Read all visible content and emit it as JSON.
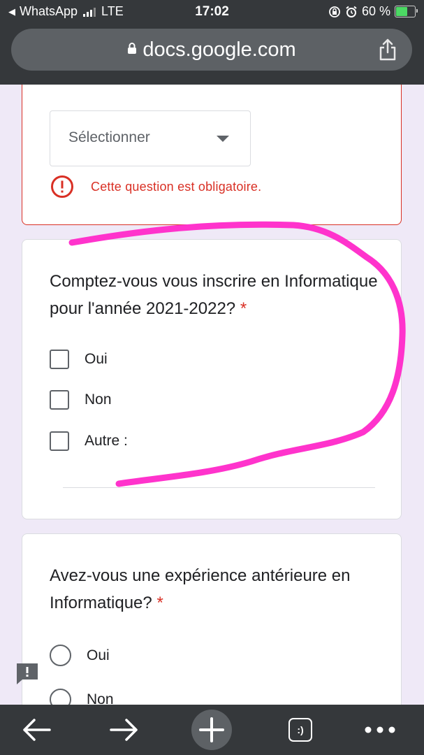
{
  "status_bar": {
    "back_app": "WhatsApp",
    "network": "LTE",
    "time": "17:02",
    "battery": "60 %",
    "battery_level": 0.6
  },
  "browser": {
    "url": "docs.google.com"
  },
  "form": {
    "error_card": {
      "select_placeholder": "Sélectionner",
      "error_message": "Cette question est obligatoire."
    },
    "question1": {
      "title": "Comptez-vous vous inscrire en Informatique pour l'année 2021-2022?",
      "required_mark": "*",
      "options": [
        "Oui",
        "Non",
        "Autre :"
      ]
    },
    "question2": {
      "title": "Avez-vous une expérience antérieure en Informatique?",
      "required_mark": "*",
      "options": [
        "Oui",
        "Non"
      ]
    }
  },
  "toolbar": {
    "tabs_label": ":)"
  },
  "colors": {
    "error_red": "#d93025",
    "annotation_pink": "#ff33cc",
    "chrome_dark": "#35383b",
    "page_bg": "#efe9f7"
  }
}
